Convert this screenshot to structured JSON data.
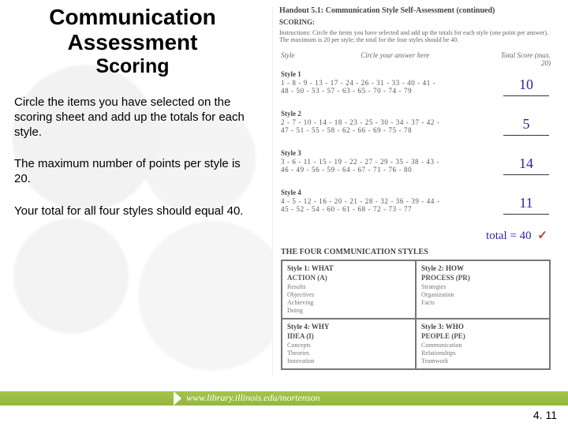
{
  "left": {
    "title_line1": "Communication",
    "title_line2": "Assessment",
    "title_line3": "Scoring",
    "para1": "Circle the items you have selected on the scoring sheet and add up the totals for each style.",
    "para2": "The maximum number of points per style is 20.",
    "para3": "Your total for all four styles should equal 40."
  },
  "handout": {
    "title": "Handout 5.1: Communication Style Self-Assessment (continued)",
    "scoring_label": "SCORING:",
    "instructions": "Instructions: Circle the items you have selected and add up the totals for each style (one point per answer). The maximum is 20 per style; the total for the four styles should be 40.",
    "col_style": "Style",
    "col_circle": "Circle your answer here",
    "col_total": "Total Score (max. 20)",
    "styles": [
      {
        "label": "Style 1",
        "line1": "1 - 8 - 9 - 13 - 17 - 24 - 26 - 31 - 33 - 40 - 41 -",
        "line2": "48 - 50 - 53 - 57 - 63 - 65 - 70 - 74 - 79",
        "score": "10"
      },
      {
        "label": "Style 2",
        "line1": "2 - 7 - 10 - 14 - 18 - 23 - 25 - 30 - 34 - 37 - 42 -",
        "line2": "47 - 51 - 55 - 58 - 62 - 66 - 69 - 75 - 78",
        "score": "5"
      },
      {
        "label": "Style 3",
        "line1": "3 - 6 - 11 - 15 - 19 - 22 - 27 - 29 - 35 - 38 - 43 -",
        "line2": "46 - 49 - 56 - 59 - 64 - 67 - 71 - 76 - 80",
        "score": "14"
      },
      {
        "label": "Style 4",
        "line1": "4 - 5 - 12 - 16 - 20 - 21 - 28 - 32 - 36 - 39 - 44 -",
        "line2": "45 - 52 - 54 - 60 - 61 - 68 - 72 - 73 - 77",
        "score": "11"
      }
    ],
    "total_text": "total = 40",
    "quad_title": "THE FOUR COMMUNICATION STYLES",
    "quad": [
      {
        "head": "Style 1: WHAT",
        "sub": "ACTION (A)",
        "lines": "Results\nObjectives\nAchieving\nDoing"
      },
      {
        "head": "Style 2: HOW",
        "sub": "PROCESS (PR)",
        "lines": "Strategies\nOrganization\nFacts"
      },
      {
        "head": "Style 4: WHY",
        "sub": "IDEA (I)",
        "lines": "Concepts\nTheories\nInnovation"
      },
      {
        "head": "Style 3: WHO",
        "sub": "PEOPLE (PE)",
        "lines": "Communication\nRelationships\nTeamwork"
      }
    ]
  },
  "footer": {
    "url": "www.library.illinois.edu/mortenson",
    "slide_number": "4. 11"
  }
}
